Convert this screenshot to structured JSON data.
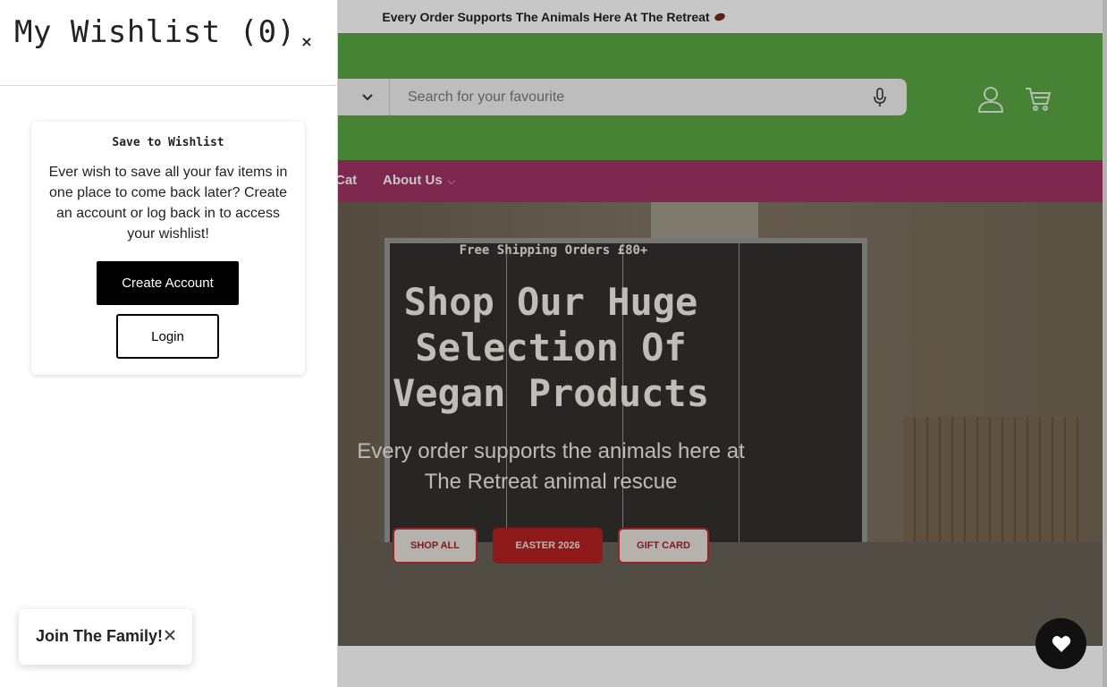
{
  "announcement": {
    "text": "Every Order Supports The Animals Here At The Retreat"
  },
  "header": {
    "search_placeholder": "Search for your favourite",
    "icons": {
      "mic": "microphone-icon",
      "account": "account-icon",
      "cart": "cart-icon",
      "category": "chevron-down-icon"
    }
  },
  "nav": {
    "items": [
      {
        "label": "Cat"
      },
      {
        "label": "About Us"
      }
    ]
  },
  "hero": {
    "shipping": "Free Shipping Orders £80+",
    "title": "Shop Our Huge Selection Of Vegan Products",
    "subtitle": "Every order supports the animals here at The Retreat animal rescue",
    "buttons": [
      {
        "label": "SHOP ALL"
      },
      {
        "label": "EASTER 2026"
      },
      {
        "label": "GIFT CARD"
      }
    ]
  },
  "wishlist": {
    "title": "My Wishlist (0)",
    "close": "×",
    "card": {
      "heading": "Save to Wishlist",
      "body": "Ever wish to save all your fav items in one place to come back later? Create an account or log back in to access your wishlist!",
      "create_label": "Create Account",
      "login_label": "Login"
    }
  },
  "join_toast": {
    "label": "Join The Family!"
  },
  "colors": {
    "header_green": "#5aa845",
    "nav_magenta": "#a23466",
    "easter_red": "#b5201f"
  }
}
